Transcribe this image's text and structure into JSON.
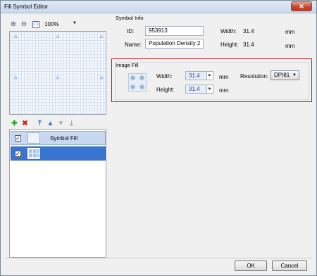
{
  "window": {
    "title": "Fill Symbol Editor",
    "close_glyph": "✕"
  },
  "preview_toolbar": {
    "zoom_in_icon": "zoom-in",
    "zoom_out_icon": "zoom-out",
    "actual_size_label": "1:1",
    "zoom_value": "100%"
  },
  "symbol_info": {
    "group_label": "Symbol Info",
    "id_label": "ID:",
    "id_value": "953913",
    "name_label": "Name:",
    "name_value": "Population Density 2",
    "width_label": "Width:",
    "width_value": "31.4",
    "width_unit": "mm",
    "height_label": "Height:",
    "height_value": "31.4",
    "height_unit": "mm"
  },
  "image_fill": {
    "group_label": "Image Fill",
    "width_label": "Width:",
    "width_value": "31.4",
    "width_unit": "mm",
    "height_label": "Height:",
    "height_value": "31.4",
    "height_unit": "mm",
    "resolution_label": "Resolution:",
    "resolution_value": "DPI81"
  },
  "layer_toolbar": {
    "add_icon": "add",
    "delete_icon": "delete",
    "move_top_icon": "move-to-top",
    "move_up_icon": "move-up",
    "move_down_icon": "move-down",
    "move_bottom_icon": "move-to-bottom"
  },
  "layers": [
    {
      "label": "Symbol Fill",
      "checked": true,
      "selected": false
    },
    {
      "label": "",
      "checked": true,
      "selected": true
    }
  ],
  "buttons": {
    "ok": "OK",
    "cancel": "Cancel"
  },
  "colors": {
    "highlight_border": "#c6161a",
    "selected_row": "#3874d2",
    "hover_row": "#c7d8f0"
  }
}
